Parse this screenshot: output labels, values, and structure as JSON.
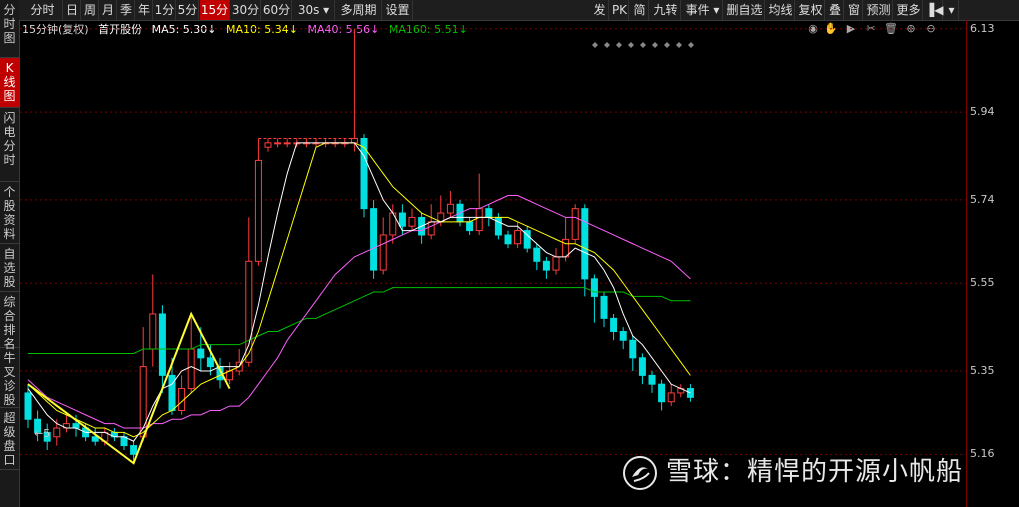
{
  "left_tabs": [
    "分时图",
    "K线图",
    "闪电分时",
    "个股资料",
    "自选股",
    "综合排名",
    "牛叉诊股",
    "超级盘口"
  ],
  "left_tab_active": 1,
  "toolbar": {
    "left": [
      "分时",
      "日",
      "周",
      "月",
      "季",
      "年",
      "1分",
      "5分",
      "15分",
      "30分",
      "60分",
      "30s ▾",
      "多周期",
      "设置"
    ],
    "active": "15分",
    "right": [
      "发",
      "PK",
      "简",
      "九转",
      "事件 ▾",
      "删自选",
      "均线",
      "复权",
      "叠",
      "窗",
      "预测",
      "更多",
      "▐◀",
      "▾"
    ]
  },
  "info": {
    "period": "15分钟(复权)",
    "stock": "首开股份",
    "ma5": "MA5: 5.30↓",
    "ma10": "MA10: 5.34↓",
    "ma40": "MA40: 5.56↓",
    "ma160": "MA160: 5.51↓"
  },
  "colors": {
    "up": "#ff3c3c",
    "down": "#00e0e0",
    "ma5": "#ffffff",
    "ma10": "#ffff00",
    "ma40": "#ff60ff",
    "ma160": "#00c000",
    "grid": "#7a0000",
    "zigzag": "#ffff33"
  },
  "right_icons": [
    "eye-icon",
    "hand-icon",
    "play-icon",
    "scissors-icon",
    "trash-icon",
    "plus-circle-icon",
    "minus-circle-icon"
  ],
  "yaxis_labels": [
    "6.13",
    "5.94",
    "5.74",
    "5.55",
    "5.35",
    "5.16"
  ],
  "marker_label": "←5",
  "watermark": "雪球：精悍的开源小帆船",
  "chart_data": {
    "type": "candlestick",
    "ylim": [
      5.04,
      6.15
    ],
    "candles": [
      [
        5.3,
        5.24,
        5.32,
        5.22
      ],
      [
        5.24,
        5.21,
        5.26,
        5.19
      ],
      [
        5.21,
        5.19,
        5.23,
        5.17
      ],
      [
        5.2,
        5.22,
        5.24,
        5.18
      ],
      [
        5.22,
        5.23,
        5.25,
        5.21
      ],
      [
        5.23,
        5.22,
        5.25,
        5.2
      ],
      [
        5.22,
        5.2,
        5.23,
        5.19
      ],
      [
        5.2,
        5.19,
        5.22,
        5.18
      ],
      [
        5.19,
        5.21,
        5.22,
        5.18
      ],
      [
        5.21,
        5.2,
        5.22,
        5.19
      ],
      [
        5.2,
        5.18,
        5.21,
        5.17
      ],
      [
        5.18,
        5.16,
        5.19,
        5.14
      ],
      [
        5.2,
        5.36,
        5.45,
        5.19
      ],
      [
        5.4,
        5.48,
        5.57,
        5.36
      ],
      [
        5.48,
        5.34,
        5.5,
        5.3
      ],
      [
        5.34,
        5.26,
        5.38,
        5.25
      ],
      [
        5.26,
        5.31,
        5.34,
        5.25
      ],
      [
        5.31,
        5.4,
        5.48,
        5.3
      ],
      [
        5.4,
        5.38,
        5.45,
        5.35
      ],
      [
        5.38,
        5.36,
        5.41,
        5.34
      ],
      [
        5.36,
        5.33,
        5.38,
        5.31
      ],
      [
        5.33,
        5.35,
        5.37,
        5.32
      ],
      [
        5.35,
        5.37,
        5.4,
        5.34
      ],
      [
        5.37,
        5.6,
        5.7,
        5.36
      ],
      [
        5.6,
        5.83,
        5.88,
        5.59
      ],
      [
        5.86,
        5.87,
        5.88,
        5.85
      ],
      [
        5.87,
        5.87,
        5.88,
        5.86
      ],
      [
        5.87,
        5.87,
        5.88,
        5.86
      ],
      [
        5.87,
        5.87,
        5.88,
        5.86
      ],
      [
        5.87,
        5.87,
        5.88,
        5.86
      ],
      [
        5.87,
        5.87,
        5.88,
        5.86
      ],
      [
        5.87,
        5.87,
        5.88,
        5.86
      ],
      [
        5.87,
        5.87,
        5.88,
        5.86
      ],
      [
        5.87,
        5.87,
        5.88,
        5.86
      ],
      [
        5.87,
        5.88,
        6.13,
        5.85
      ],
      [
        5.88,
        5.72,
        5.89,
        5.7
      ],
      [
        5.72,
        5.58,
        5.74,
        5.56
      ],
      [
        5.58,
        5.66,
        5.7,
        5.57
      ],
      [
        5.66,
        5.71,
        5.73,
        5.64
      ],
      [
        5.71,
        5.68,
        5.73,
        5.66
      ],
      [
        5.68,
        5.7,
        5.72,
        5.67
      ],
      [
        5.7,
        5.66,
        5.71,
        5.64
      ],
      [
        5.66,
        5.69,
        5.73,
        5.65
      ],
      [
        5.69,
        5.71,
        5.75,
        5.68
      ],
      [
        5.71,
        5.73,
        5.76,
        5.7
      ],
      [
        5.73,
        5.69,
        5.74,
        5.68
      ],
      [
        5.69,
        5.67,
        5.7,
        5.66
      ],
      [
        5.67,
        5.72,
        5.8,
        5.66
      ],
      [
        5.72,
        5.7,
        5.73,
        5.68
      ],
      [
        5.7,
        5.66,
        5.71,
        5.65
      ],
      [
        5.66,
        5.64,
        5.67,
        5.63
      ],
      [
        5.64,
        5.67,
        5.69,
        5.63
      ],
      [
        5.67,
        5.63,
        5.68,
        5.62
      ],
      [
        5.63,
        5.6,
        5.64,
        5.58
      ],
      [
        5.6,
        5.58,
        5.61,
        5.56
      ],
      [
        5.58,
        5.61,
        5.63,
        5.57
      ],
      [
        5.61,
        5.65,
        5.7,
        5.6
      ],
      [
        5.65,
        5.72,
        5.73,
        5.64
      ],
      [
        5.72,
        5.56,
        5.73,
        5.52
      ],
      [
        5.56,
        5.52,
        5.57,
        5.46
      ],
      [
        5.52,
        5.47,
        5.53,
        5.45
      ],
      [
        5.47,
        5.44,
        5.48,
        5.42
      ],
      [
        5.44,
        5.42,
        5.45,
        5.4
      ],
      [
        5.42,
        5.38,
        5.43,
        5.35
      ],
      [
        5.38,
        5.34,
        5.39,
        5.32
      ],
      [
        5.34,
        5.32,
        5.35,
        5.3
      ],
      [
        5.32,
        5.28,
        5.33,
        5.26
      ],
      [
        5.28,
        5.3,
        5.32,
        5.27
      ],
      [
        5.3,
        5.31,
        5.32,
        5.29
      ],
      [
        5.31,
        5.29,
        5.32,
        5.28
      ]
    ],
    "ma5": [
      5.31,
      5.28,
      5.25,
      5.23,
      5.22,
      5.22,
      5.21,
      5.21,
      5.21,
      5.2,
      5.2,
      5.19,
      5.22,
      5.27,
      5.31,
      5.32,
      5.35,
      5.36,
      5.35,
      5.35,
      5.36,
      5.36,
      5.36,
      5.41,
      5.5,
      5.61,
      5.71,
      5.8,
      5.87,
      5.87,
      5.87,
      5.87,
      5.87,
      5.87,
      5.87,
      5.84,
      5.79,
      5.74,
      5.71,
      5.67,
      5.67,
      5.68,
      5.69,
      5.69,
      5.7,
      5.7,
      5.7,
      5.7,
      5.7,
      5.69,
      5.68,
      5.68,
      5.66,
      5.64,
      5.62,
      5.61,
      5.61,
      5.63,
      5.62,
      5.61,
      5.58,
      5.54,
      5.48,
      5.43,
      5.41,
      5.38,
      5.35,
      5.32,
      5.31,
      5.3
    ],
    "ma10": [
      5.32,
      5.3,
      5.28,
      5.26,
      5.25,
      5.24,
      5.23,
      5.22,
      5.22,
      5.21,
      5.21,
      5.2,
      5.21,
      5.23,
      5.25,
      5.26,
      5.28,
      5.3,
      5.32,
      5.33,
      5.34,
      5.35,
      5.36,
      5.39,
      5.44,
      5.51,
      5.58,
      5.65,
      5.72,
      5.79,
      5.86,
      5.87,
      5.87,
      5.87,
      5.87,
      5.86,
      5.83,
      5.8,
      5.77,
      5.75,
      5.73,
      5.71,
      5.7,
      5.69,
      5.69,
      5.69,
      5.69,
      5.7,
      5.7,
      5.7,
      5.7,
      5.69,
      5.68,
      5.67,
      5.66,
      5.65,
      5.64,
      5.64,
      5.63,
      5.62,
      5.6,
      5.58,
      5.55,
      5.52,
      5.49,
      5.46,
      5.43,
      5.4,
      5.37,
      5.34
    ],
    "ma40": [
      5.33,
      5.31,
      5.29,
      5.28,
      5.27,
      5.26,
      5.25,
      5.24,
      5.23,
      5.23,
      5.22,
      5.22,
      5.22,
      5.23,
      5.23,
      5.24,
      5.24,
      5.25,
      5.25,
      5.26,
      5.26,
      5.27,
      5.27,
      5.29,
      5.32,
      5.35,
      5.38,
      5.42,
      5.45,
      5.48,
      5.51,
      5.54,
      5.57,
      5.59,
      5.61,
      5.62,
      5.63,
      5.64,
      5.65,
      5.66,
      5.67,
      5.67,
      5.68,
      5.69,
      5.7,
      5.71,
      5.72,
      5.72,
      5.73,
      5.74,
      5.75,
      5.75,
      5.74,
      5.73,
      5.72,
      5.71,
      5.7,
      5.7,
      5.69,
      5.68,
      5.67,
      5.66,
      5.65,
      5.64,
      5.63,
      5.62,
      5.61,
      5.6,
      5.58,
      5.56
    ],
    "ma160": [
      5.39,
      5.39,
      5.39,
      5.39,
      5.39,
      5.39,
      5.39,
      5.39,
      5.39,
      5.39,
      5.39,
      5.39,
      5.4,
      5.4,
      5.4,
      5.4,
      5.4,
      5.4,
      5.41,
      5.41,
      5.41,
      5.41,
      5.41,
      5.42,
      5.43,
      5.44,
      5.44,
      5.45,
      5.46,
      5.47,
      5.47,
      5.48,
      5.49,
      5.5,
      5.51,
      5.52,
      5.53,
      5.53,
      5.54,
      5.54,
      5.54,
      5.54,
      5.54,
      5.54,
      5.54,
      5.54,
      5.54,
      5.54,
      5.54,
      5.54,
      5.54,
      5.54,
      5.54,
      5.54,
      5.54,
      5.54,
      5.54,
      5.54,
      5.54,
      5.53,
      5.53,
      5.53,
      5.53,
      5.52,
      5.52,
      5.52,
      5.52,
      5.51,
      5.51,
      5.51
    ],
    "zigzag": [
      [
        0,
        5.32
      ],
      [
        11,
        5.14
      ],
      [
        17,
        5.48
      ],
      [
        21,
        5.31
      ]
    ]
  }
}
